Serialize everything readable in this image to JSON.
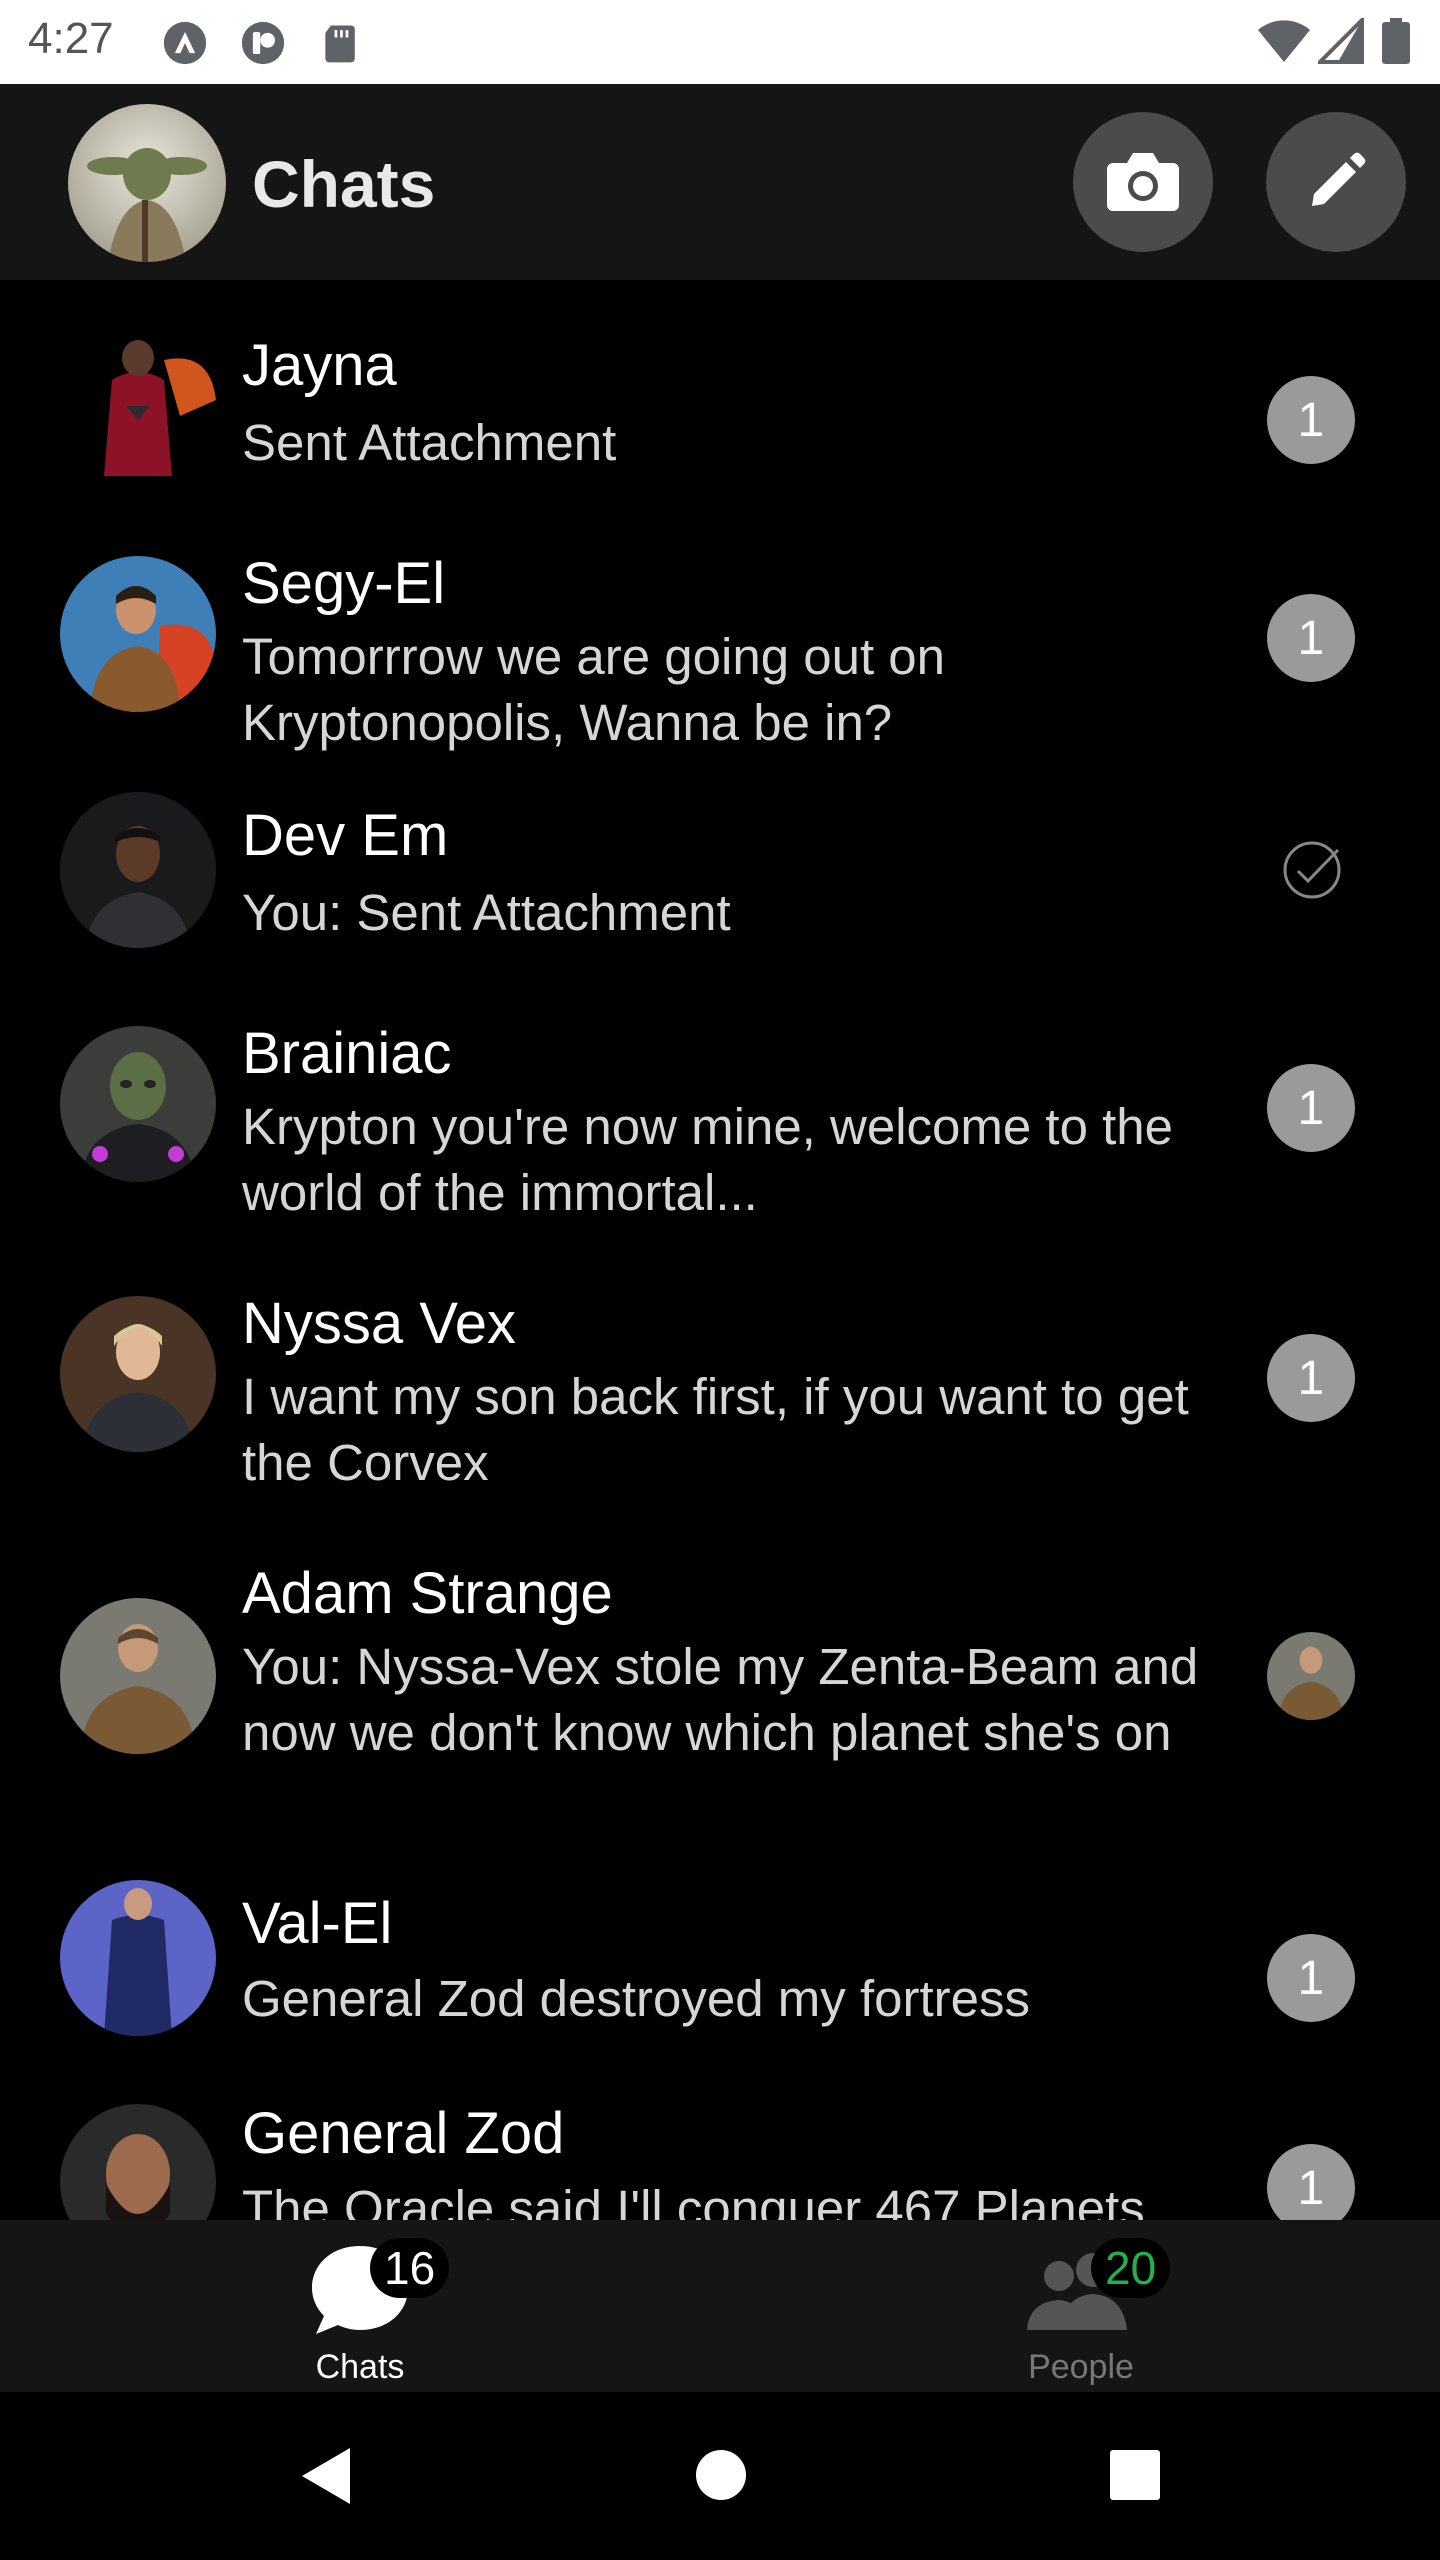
{
  "status_bar": {
    "time": "4:27"
  },
  "app_bar": {
    "title": "Chats"
  },
  "conversations": [
    {
      "name": "Jayna",
      "message": "Sent Attachment",
      "unread": "1"
    },
    {
      "name": "Segy-El",
      "message": "Tomorrrow we are going out on Kryptonopolis, Wanna be in?",
      "unread": "1"
    },
    {
      "name": "Dev Em",
      "message": "You:  Sent Attachment",
      "status": "seen"
    },
    {
      "name": "Brainiac",
      "message": "Krypton you're now mine, welcome to the world of the immortal...",
      "unread": "1"
    },
    {
      "name": "Nyssa Vex",
      "message": "I want my son back first, if you want to get the Corvex",
      "unread": "1"
    },
    {
      "name": "Adam Strange",
      "message": "You:   Nyssa-Vex stole my Zenta-Beam and now we don't know which planet she's on",
      "status": "read"
    },
    {
      "name": "Val-El",
      "message": "General Zod destroyed my fortress",
      "unread": "1"
    },
    {
      "name": "General Zod",
      "message": "The Oracle said I'll conquer 467 Planets",
      "unread": "1"
    }
  ],
  "tabs": {
    "chats": {
      "label": "Chats",
      "count": "16"
    },
    "people": {
      "label": "People",
      "count": "20"
    }
  },
  "colors": {
    "app_bar": "#151515",
    "background": "#000000",
    "badge": "#9a9a9a",
    "people_count": "#22b14c"
  }
}
